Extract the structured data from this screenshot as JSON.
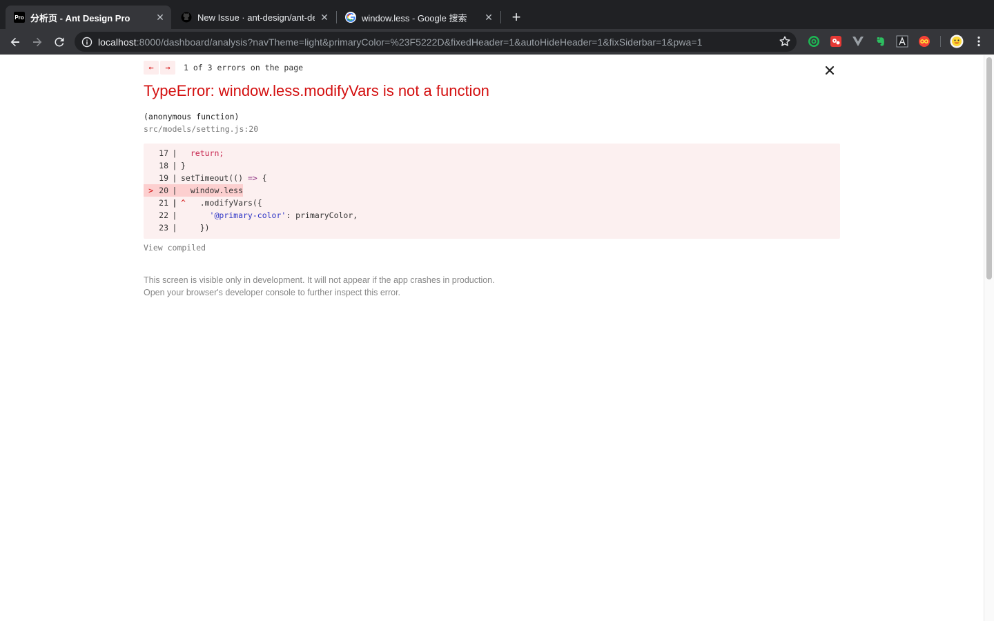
{
  "browser": {
    "tabs": [
      {
        "favicon": "Pro",
        "title": "分析页 - Ant Design Pro",
        "active": true
      },
      {
        "favicon": "github-icon",
        "title": "New Issue · ant-design/ant-de",
        "active": false
      },
      {
        "favicon": "google-icon",
        "title": "window.less - Google 搜索",
        "active": false
      }
    ],
    "new_tab_symbol": "+",
    "url_host": "localhost",
    "url_rest": ":8000/dashboard/analysis?navTheme=light&primaryColor=%23F5222D&fixedHeader=1&autoHideHeader=1&fixSiderbar=1&pwa=1",
    "extensions": [
      "target-icon",
      "red-puzzle-icon",
      "vue-icon",
      "evernote-icon",
      "font-icon",
      "infinity-icon"
    ]
  },
  "overlay": {
    "prev_arrow": "←",
    "next_arrow": "→",
    "error_count": "1 of 3 errors on the page",
    "title": "TypeError: window.less.modifyVars is not a function",
    "function_name": "(anonymous function)",
    "file_location": "src/models/setting.js:20",
    "code": [
      {
        "marker": "",
        "num": "17",
        "sep": "|",
        "code": "  return;"
      },
      {
        "marker": "",
        "num": "18",
        "sep": "|",
        "code": "}"
      },
      {
        "marker": "",
        "num": "19",
        "sep": "|",
        "code": "setTimeout(() => {"
      },
      {
        "marker": ">",
        "num": "20",
        "sep": "|",
        "code": "  window.less"
      },
      {
        "marker": "",
        "num": "21",
        "sep": "|",
        "code": "^   .modifyVars({"
      },
      {
        "marker": "",
        "num": "22",
        "sep": "|",
        "code": "      '@primary-color': primaryColor,"
      },
      {
        "marker": "",
        "num": "23",
        "sep": "|",
        "code": "    })"
      }
    ],
    "view_compiled": "View compiled",
    "note_line1": "This screen is visible only in development. It will not appear if the app crashes in production.",
    "note_line2": "Open your browser's developer console to further inspect this error."
  }
}
